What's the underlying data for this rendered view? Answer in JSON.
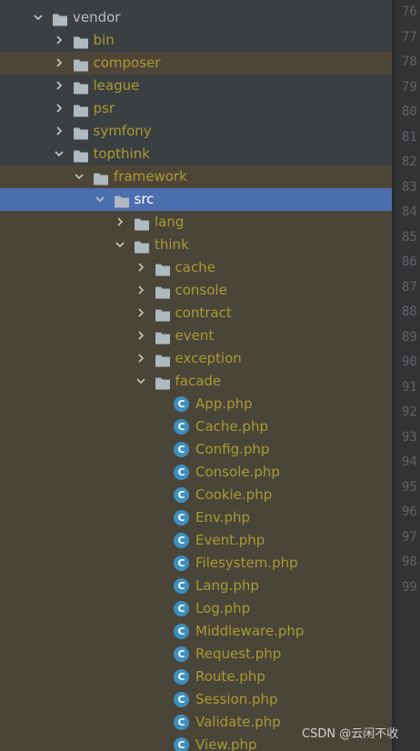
{
  "tree": {
    "items": [
      {
        "label": "vendor",
        "level": 0,
        "expanded": true,
        "type": "folder",
        "style": "normal"
      },
      {
        "label": "bin",
        "level": 1,
        "expanded": false,
        "type": "folder",
        "style": "olive"
      },
      {
        "label": "composer",
        "level": 1,
        "expanded": false,
        "type": "folder",
        "style": "olive",
        "highlight": true
      },
      {
        "label": "league",
        "level": 1,
        "expanded": false,
        "type": "folder",
        "style": "olive"
      },
      {
        "label": "psr",
        "level": 1,
        "expanded": false,
        "type": "folder",
        "style": "olive"
      },
      {
        "label": "symfony",
        "level": 1,
        "expanded": false,
        "type": "folder",
        "style": "olive"
      },
      {
        "label": "topthink",
        "level": 1,
        "expanded": true,
        "type": "folder",
        "style": "olive"
      },
      {
        "label": "framework",
        "level": 2,
        "expanded": true,
        "type": "folder",
        "style": "olive",
        "highlight": true
      },
      {
        "label": "src",
        "level": 3,
        "expanded": true,
        "type": "folder",
        "style": "olive",
        "selected": true
      },
      {
        "label": "lang",
        "level": 4,
        "expanded": false,
        "type": "folder",
        "style": "olive"
      },
      {
        "label": "think",
        "level": 4,
        "expanded": true,
        "type": "folder",
        "style": "olive"
      },
      {
        "label": "cache",
        "level": 5,
        "expanded": false,
        "type": "folder",
        "style": "olive"
      },
      {
        "label": "console",
        "level": 5,
        "expanded": false,
        "type": "folder",
        "style": "olive"
      },
      {
        "label": "contract",
        "level": 5,
        "expanded": false,
        "type": "folder",
        "style": "olive"
      },
      {
        "label": "event",
        "level": 5,
        "expanded": false,
        "type": "folder",
        "style": "olive"
      },
      {
        "label": "exception",
        "level": 5,
        "expanded": false,
        "type": "folder",
        "style": "olive"
      },
      {
        "label": "facade",
        "level": 5,
        "expanded": true,
        "type": "folder",
        "style": "olive"
      },
      {
        "label": "App.php",
        "level": 6,
        "type": "class"
      },
      {
        "label": "Cache.php",
        "level": 6,
        "type": "class"
      },
      {
        "label": "Config.php",
        "level": 6,
        "type": "class"
      },
      {
        "label": "Console.php",
        "level": 6,
        "type": "class"
      },
      {
        "label": "Cookie.php",
        "level": 6,
        "type": "class"
      },
      {
        "label": "Env.php",
        "level": 6,
        "type": "class"
      },
      {
        "label": "Event.php",
        "level": 6,
        "type": "class"
      },
      {
        "label": "Filesystem.php",
        "level": 6,
        "type": "class"
      },
      {
        "label": "Lang.php",
        "level": 6,
        "type": "class"
      },
      {
        "label": "Log.php",
        "level": 6,
        "type": "class"
      },
      {
        "label": "Middleware.php",
        "level": 6,
        "type": "class"
      },
      {
        "label": "Request.php",
        "level": 6,
        "type": "class"
      },
      {
        "label": "Route.php",
        "level": 6,
        "type": "class"
      },
      {
        "label": "Session.php",
        "level": 6,
        "type": "class"
      },
      {
        "label": "Validate.php",
        "level": 6,
        "type": "class"
      },
      {
        "label": "View.php",
        "level": 6,
        "type": "class"
      }
    ],
    "class_icon_letter": "C"
  },
  "gutter": {
    "line_numbers": [
      "76",
      "77",
      "78",
      "79",
      "80",
      "81",
      "82",
      "83",
      "84",
      "85",
      "86",
      "87",
      "88",
      "89",
      "90",
      "91",
      "92",
      "93",
      "94",
      "95",
      "96",
      "97",
      "98",
      "99"
    ]
  },
  "watermark": "CSDN @云闲不收",
  "colors": {
    "folder_label": "#a79a32",
    "selection": "#4b6eaf",
    "class_icon": "#3d8fbf"
  }
}
